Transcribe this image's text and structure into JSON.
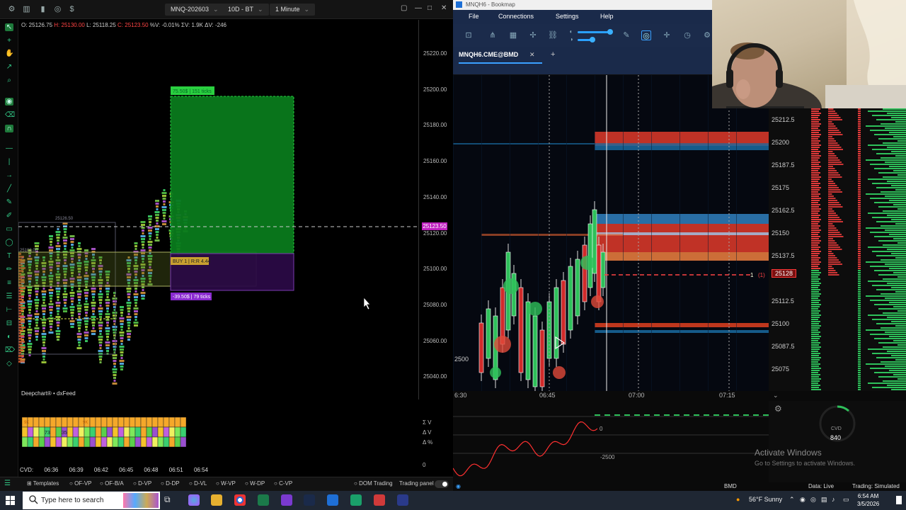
{
  "deepchart": {
    "toolbar": {
      "symbol": "MNQ-202603",
      "range": "10D - BT",
      "interval": "1 Minute"
    },
    "ohlc": {
      "o": "O: 25126.75",
      "h": "H: 25130.00",
      "l": "L: 25118.25",
      "c": "C: 25123.50",
      "pct": "%V: -0.01%",
      "sv": "ΣV: 1.9K",
      "dv": "ΔV: -246"
    },
    "price_axis": [
      "25220.00",
      "25200.00",
      "25180.00",
      "25160.00",
      "25140.00",
      "25120.00",
      "25100.00",
      "25080.00",
      "25060.00",
      "25040.00"
    ],
    "last_price": "25123.50",
    "position_tp": "75.50$ | 151 ticks",
    "position_entry": "BUY 1 | R:R 4.44",
    "position_sl": "-39.50$ | 79 ticks",
    "level_a": "25126.50",
    "level_b": "25109.00",
    "brand": "Deepchart® • dxFeed",
    "stats": {
      "sigma_v": "Σ V",
      "delta_v": "Δ V",
      "delta_pct": "Δ %",
      "zero": "0"
    },
    "footprint_marks": {
      "a": "9K",
      "b": "9K",
      "c": "73",
      "d": "35"
    },
    "cvd_label": "CVD:",
    "times": [
      "06:36",
      "06:39",
      "06:42",
      "06:45",
      "06:48",
      "06:51",
      "06:54"
    ],
    "bottom": {
      "templates": "Templates",
      "tabs": [
        "OF-VP",
        "OF-B/A",
        "D-VP",
        "D-DP",
        "D-VL",
        "W-VP",
        "W-DP",
        "C-VP"
      ],
      "dom": "DOM Trading",
      "trading_panel": "Trading panel"
    }
  },
  "bookmap": {
    "title": "MNQH6 - Bookmap",
    "menu": [
      "File",
      "Connections",
      "Settings",
      "Help"
    ],
    "tab": "MNQH6.CME@BMD",
    "ladder_prices": [
      "25212.5",
      "25200",
      "25187.5",
      "25175",
      "25162.5",
      "25150",
      "25137.5",
      "25128",
      "25112.5",
      "25100",
      "25087.5",
      "25075"
    ],
    "position_label": "1",
    "position_count": "(1)",
    "left_level": "2500",
    "time_axis": [
      "6:30",
      "06:45",
      "07:00",
      "07:15"
    ],
    "cvd_value": "-2500",
    "cvd_zero": "0",
    "cvd_gauge": {
      "label": "CVD",
      "value": "840"
    },
    "status": {
      "bmd": "BMD",
      "data": "Data: Live",
      "trading": "Trading: Simulated"
    },
    "activate": {
      "line1": "Activate Windows",
      "line2": "Go to Settings to activate Windows."
    }
  },
  "taskbar": {
    "search_placeholder": "Type here to search",
    "weather": "56°F  Sunny",
    "time": "6:54 AM",
    "date": "3/5/2026"
  },
  "colors": {
    "buy_green": "#33dd55",
    "sell_red": "#ff3a3a",
    "accent_blue": "#3aa0ff",
    "position_purple": "#2a0a44"
  }
}
